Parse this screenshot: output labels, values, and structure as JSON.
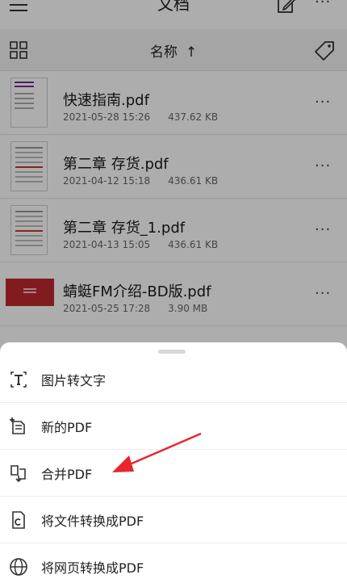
{
  "header": {
    "title": "文档"
  },
  "sortbar": {
    "sort_label": "名称",
    "sort_arrow": "↑"
  },
  "files": [
    {
      "name": "快速指南.pdf",
      "date": "2021-05-28 15:26",
      "size": "437.62 KB"
    },
    {
      "name": "第二章  存货.pdf",
      "date": "2021-04-12 15:18",
      "size": "436.61 KB"
    },
    {
      "name": "第二章  存货_1.pdf",
      "date": "2021-04-13 15:05",
      "size": "436.61 KB"
    },
    {
      "name": "蜻蜓FM介绍-BD版.pdf",
      "date": "2021-05-25 17:28",
      "size": "3.90 MB"
    }
  ],
  "more_glyph": "···",
  "sheet": {
    "actions": [
      {
        "label": "图片转文字",
        "icon": "image-to-text-icon"
      },
      {
        "label": "新的PDF",
        "icon": "new-pdf-icon"
      },
      {
        "label": "合并PDF",
        "icon": "merge-pdf-icon"
      },
      {
        "label": "将文件转换成PDF",
        "icon": "file-convert-icon"
      },
      {
        "label": "将网页转换成PDF",
        "icon": "globe-icon"
      }
    ]
  },
  "colors": {
    "annotation_arrow": "#e8262e",
    "dim_overlay": "rgba(0,0,0,0.32)"
  }
}
